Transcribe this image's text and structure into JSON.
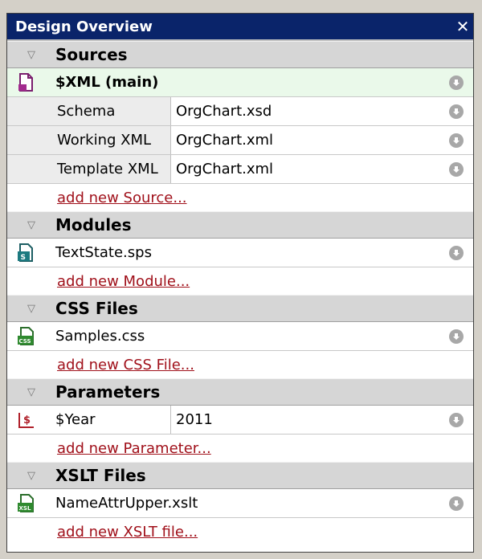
{
  "panel": {
    "title": "Design Overview",
    "close_glyph": "✕"
  },
  "sections": {
    "sources": {
      "header": "Sources",
      "main_label": "$XML (main)",
      "props": [
        {
          "key": "Schema",
          "value": "OrgChart.xsd"
        },
        {
          "key": "Working XML",
          "value": "OrgChart.xml"
        },
        {
          "key": "Template XML",
          "value": "OrgChart.xml"
        }
      ],
      "add_link": "add new Source..."
    },
    "modules": {
      "header": "Modules",
      "items": [
        {
          "label": "TextState.sps",
          "icon": "sps-file-icon"
        }
      ],
      "add_link": "add new Module..."
    },
    "css": {
      "header": "CSS Files",
      "items": [
        {
          "label": "Samples.css",
          "icon": "css-file-icon"
        }
      ],
      "add_link": "add new CSS File..."
    },
    "parameters": {
      "header": "Parameters",
      "items": [
        {
          "key": "$Year",
          "value": "2011",
          "icon": "parameter-icon"
        }
      ],
      "add_link": "add new Parameter..."
    },
    "xslt": {
      "header": "XSLT Files",
      "items": [
        {
          "label": "NameAttrUpper.xslt",
          "icon": "xslt-file-icon"
        }
      ],
      "add_link": "add new XSLT file..."
    }
  },
  "colors": {
    "titlebar": "#0a246a",
    "link": "#a0101a",
    "main_row_bg": "#eaf9ea",
    "section_header_bg": "#d6d6d6"
  }
}
